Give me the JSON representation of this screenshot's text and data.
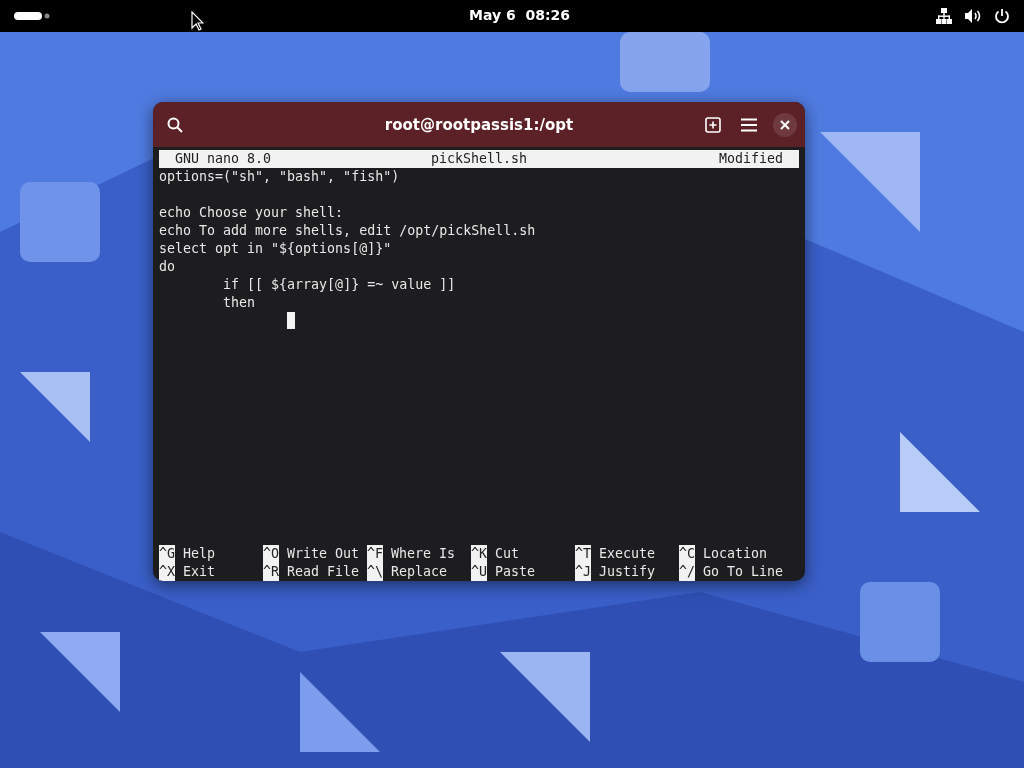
{
  "top_bar": {
    "clock": "May 6  08:26"
  },
  "window": {
    "title": "root@rootpassis1:/opt"
  },
  "nano": {
    "version": "GNU nano 8.0",
    "filename": "pickShell.sh",
    "status": "Modified",
    "lines": [
      {
        "kind": "text",
        "text": "options=(\"sh\", \"bash\", \"fish\")"
      },
      {
        "kind": "blank"
      },
      {
        "kind": "text",
        "text": "echo Choose your shell:"
      },
      {
        "kind": "text",
        "text": "echo To add more shells, edit /opt/pickShell.sh"
      },
      {
        "kind": "text",
        "text": "select opt in \"${options[@]}\""
      },
      {
        "kind": "text",
        "text": "do"
      },
      {
        "kind": "text",
        "text": "\tif [[ ${array[@]} =~ value ]]"
      },
      {
        "kind": "text",
        "text": "\tthen"
      },
      {
        "kind": "cursor"
      }
    ],
    "shortcuts": [
      [
        {
          "key": "^G",
          "label": "Help"
        },
        {
          "key": "^O",
          "label": "Write Out"
        },
        {
          "key": "^F",
          "label": "Where Is"
        },
        {
          "key": "^K",
          "label": "Cut"
        },
        {
          "key": "^T",
          "label": "Execute"
        },
        {
          "key": "^C",
          "label": "Location"
        }
      ],
      [
        {
          "key": "^X",
          "label": "Exit"
        },
        {
          "key": "^R",
          "label": "Read File"
        },
        {
          "key": "^\\",
          "label": "Replace"
        },
        {
          "key": "^U",
          "label": "Paste"
        },
        {
          "key": "^J",
          "label": "Justify"
        },
        {
          "key": "^/",
          "label": "Go To Line"
        }
      ]
    ]
  }
}
